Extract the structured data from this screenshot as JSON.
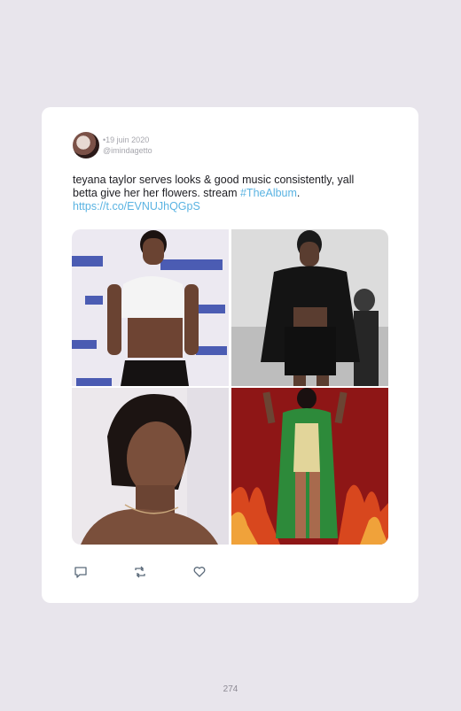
{
  "tweet": {
    "date": "19 juin 2020",
    "handle": "@imindagetto",
    "text_part1": "teyana taylor serves looks & good music consistently, yall betta give her her flowers. stream ",
    "hashtag": "#TheAlbum",
    "text_part2": ". ",
    "url": "https://t.co/EVNUJhQGpS"
  },
  "media": [
    {
      "name": "photo-white-crop-top"
    },
    {
      "name": "photo-black-outfit-runway"
    },
    {
      "name": "photo-portrait"
    },
    {
      "name": "photo-green-fringe-red-background"
    }
  ],
  "actions": [
    "reply-icon",
    "retweet-icon",
    "like-icon"
  ],
  "page": {
    "number": "274"
  },
  "colors": {
    "background": "#e8e5ec",
    "card": "#ffffff",
    "link": "#5ab3e2",
    "meta": "#a6a6ad"
  }
}
